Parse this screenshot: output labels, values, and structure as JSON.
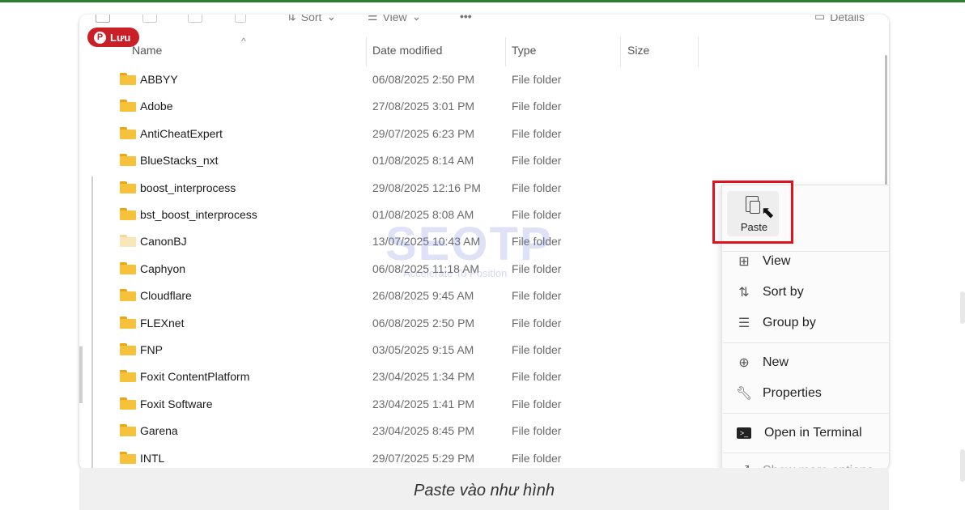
{
  "toolbar": {
    "sort_label": "Sort",
    "view_label": "View",
    "more_label": "•••",
    "details_label": "Details"
  },
  "save_button": {
    "label": "Lưu",
    "icon": "pinterest-icon"
  },
  "columns": {
    "name": "Name",
    "date": "Date modified",
    "type": "Type",
    "size": "Size"
  },
  "files": [
    {
      "name": "ABBYY",
      "date": "06/08/2025 2:50 PM",
      "type": "File folder"
    },
    {
      "name": "Adobe",
      "date": "27/08/2025 3:01 PM",
      "type": "File folder"
    },
    {
      "name": "AntiCheatExpert",
      "date": "29/07/2025 6:23 PM",
      "type": "File folder"
    },
    {
      "name": "BlueStacks_nxt",
      "date": "01/08/2025 8:14 AM",
      "type": "File folder"
    },
    {
      "name": "boost_interprocess",
      "date": "29/08/2025 12:16 PM",
      "type": "File folder"
    },
    {
      "name": "bst_boost_interprocess",
      "date": "01/08/2025 8:08 AM",
      "type": "File folder"
    },
    {
      "name": "CanonBJ",
      "date": "13/07/2025 10:43 AM",
      "type": "File folder"
    },
    {
      "name": "Caphyon",
      "date": "06/08/2025 11:18 AM",
      "type": "File folder"
    },
    {
      "name": "Cloudflare",
      "date": "26/08/2025 9:45 AM",
      "type": "File folder"
    },
    {
      "name": "FLEXnet",
      "date": "06/08/2025 2:50 PM",
      "type": "File folder"
    },
    {
      "name": "FNP",
      "date": "03/05/2025 9:15 AM",
      "type": "File folder"
    },
    {
      "name": "Foxit ContentPlatform",
      "date": "23/04/2025 1:34 PM",
      "type": "File folder"
    },
    {
      "name": "Foxit Software",
      "date": "23/04/2025 1:41 PM",
      "type": "File folder"
    },
    {
      "name": "Garena",
      "date": "23/04/2025 8:45 PM",
      "type": "File folder"
    },
    {
      "name": "INTL",
      "date": "29/07/2025 5:29 PM",
      "type": "File folder"
    }
  ],
  "context_menu": {
    "paste": "Paste",
    "view": "View",
    "sort_by": "Sort by",
    "group_by": "Group by",
    "new": "New",
    "properties": "Properties",
    "open_terminal": "Open in Terminal",
    "more_options": "Show more options"
  },
  "watermark": {
    "title": "SEOTP",
    "subtitle": "Accelerate To Position"
  },
  "caption": "Paste vào như hình"
}
